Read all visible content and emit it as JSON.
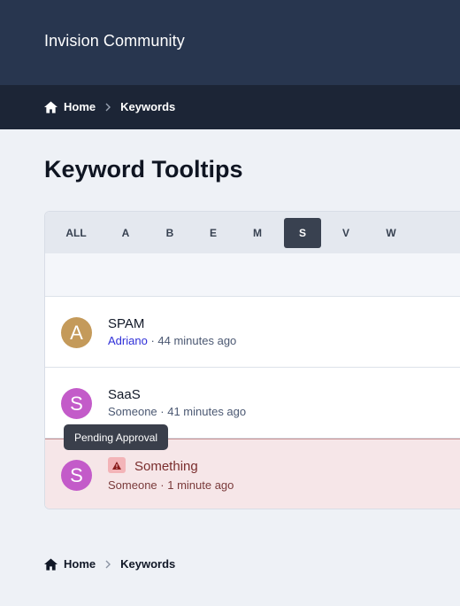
{
  "header": {
    "site_title": "Invision Community"
  },
  "breadcrumb": {
    "home": "Home",
    "current": "Keywords"
  },
  "page": {
    "title": "Keyword Tooltips"
  },
  "tabs": [
    {
      "label": "ALL",
      "active": false
    },
    {
      "label": "A",
      "active": false
    },
    {
      "label": "B",
      "active": false
    },
    {
      "label": "E",
      "active": false
    },
    {
      "label": "M",
      "active": false
    },
    {
      "label": "S",
      "active": true
    },
    {
      "label": "V",
      "active": false
    },
    {
      "label": "W",
      "active": false
    }
  ],
  "items": [
    {
      "avatar_letter": "A",
      "avatar_color": "#c49a5a",
      "title": "SPAM",
      "author": "Adriano",
      "time": "44 minutes ago",
      "pending": false
    },
    {
      "avatar_letter": "S",
      "avatar_color": "#c35bc9",
      "title": "SaaS",
      "author": "Someone",
      "time": "41 minutes ago",
      "pending": false
    },
    {
      "avatar_letter": "S",
      "avatar_color": "#c35bc9",
      "title": "Something",
      "author": "Someone",
      "time": "1 minute ago",
      "pending": true
    }
  ],
  "tooltip": {
    "text": "Pending Approval"
  },
  "meta_separator": "·",
  "colors": {
    "header_bg": "#28364f",
    "crumb_bg": "#1c2536",
    "active_tab": "#394150",
    "pending_bg": "#f6e6e8",
    "link": "#2f2fd8"
  }
}
